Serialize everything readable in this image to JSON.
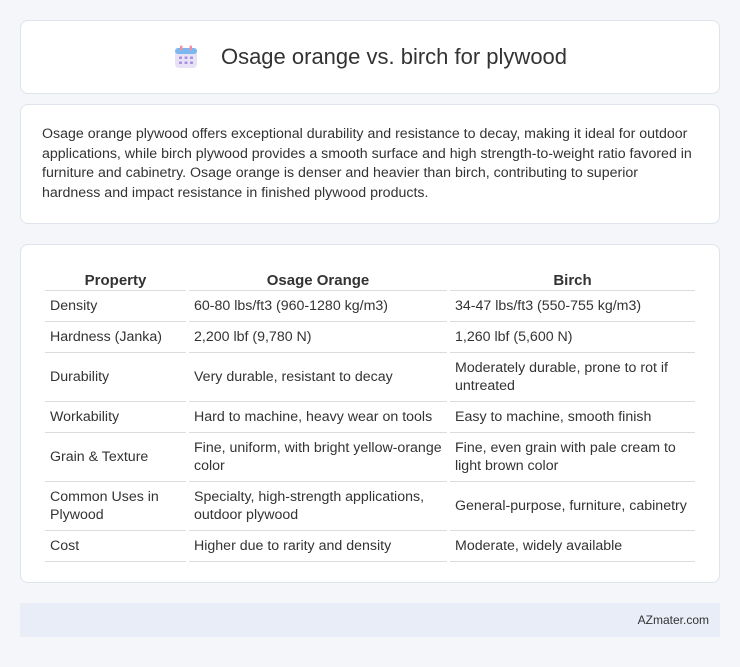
{
  "header": {
    "title": "Osage orange vs. birch for plywood",
    "icon": "calendar-icon"
  },
  "summary": {
    "text": "Osage orange plywood offers exceptional durability and resistance to decay, making it ideal for outdoor applications, while birch plywood provides a smooth surface and high strength-to-weight ratio favored in furniture and cabinetry. Osage orange is denser and heavier than birch, contributing to superior hardness and impact resistance in finished plywood products."
  },
  "table": {
    "headers": [
      "Property",
      "Osage Orange",
      "Birch"
    ],
    "rows": [
      [
        "Density",
        "60-80 lbs/ft3 (960-1280 kg/m3)",
        "34-47 lbs/ft3 (550-755 kg/m3)"
      ],
      [
        "Hardness (Janka)",
        "2,200 lbf (9,780 N)",
        "1,260 lbf (5,600 N)"
      ],
      [
        "Durability",
        "Very durable, resistant to decay",
        "Moderately durable, prone to rot if untreated"
      ],
      [
        "Workability",
        "Hard to machine, heavy wear on tools",
        "Easy to machine, smooth finish"
      ],
      [
        "Grain & Texture",
        "Fine, uniform, with bright yellow-orange color",
        "Fine, even grain with pale cream to light brown color"
      ],
      [
        "Common Uses in Plywood",
        "Specialty, high-strength applications, outdoor plywood",
        "General-purpose, furniture, cabinetry"
      ],
      [
        "Cost",
        "Higher due to rarity and density",
        "Moderate, widely available"
      ]
    ]
  },
  "footer": {
    "site": "AZmater.com"
  }
}
